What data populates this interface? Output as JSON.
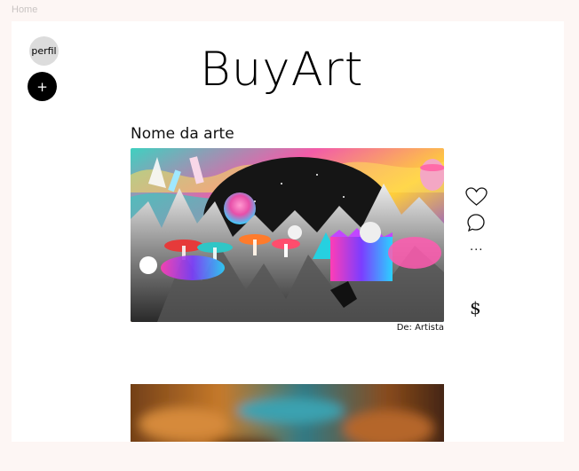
{
  "nav": {
    "home_label": "Home"
  },
  "sidebar": {
    "profile_label": "perfil",
    "add_label": "+"
  },
  "header": {
    "logo_text": "BuyArt"
  },
  "post": {
    "title": "Nome da arte",
    "artist": "De: Artista",
    "actions": {
      "more_label": "...",
      "price_label": "$"
    }
  },
  "icons": [
    "heart-icon",
    "comment-icon",
    "more-icon",
    "dollar-icon"
  ],
  "colors": {
    "page_bg": "#ffffff",
    "outer_bg": "#fdf6f4",
    "add_button": "#000000",
    "profile_button": "#dcdcdc"
  }
}
